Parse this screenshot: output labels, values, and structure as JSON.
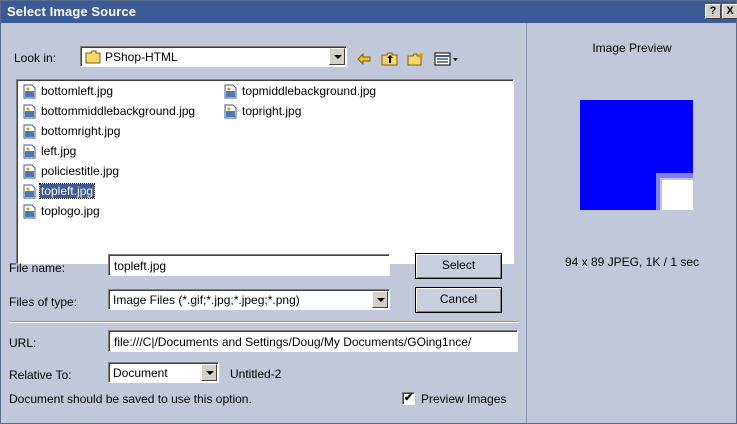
{
  "window": {
    "title": "Select Image Source",
    "help_label": "?",
    "close_label": "X"
  },
  "look_in": {
    "label": "Look in:",
    "value": "PShop-HTML"
  },
  "toolbar": {
    "back_icon": "back-arrow-icon",
    "up_icon": "up-folder-icon",
    "new_folder_icon": "new-folder-icon",
    "view_menu_icon": "view-menu-icon"
  },
  "files": [
    {
      "name": "bottomleft.jpg",
      "selected": false
    },
    {
      "name": "bottommiddlebackground.jpg",
      "selected": false
    },
    {
      "name": "bottomright.jpg",
      "selected": false
    },
    {
      "name": "left.jpg",
      "selected": false
    },
    {
      "name": "policiestitle.jpg",
      "selected": false
    },
    {
      "name": "topleft.jpg",
      "selected": true
    },
    {
      "name": "toplogo.jpg",
      "selected": false
    },
    {
      "name": "topmiddlebackground.jpg",
      "selected": false
    },
    {
      "name": "topright.jpg",
      "selected": false
    }
  ],
  "file_name": {
    "label": "File name:",
    "value": "topleft.jpg"
  },
  "files_of_type": {
    "label": "Files of type:",
    "value": "Image Files (*.gif;*.jpg;*.jpeg;*.png)"
  },
  "buttons": {
    "select": "Select",
    "cancel": "Cancel"
  },
  "url": {
    "label": "URL:",
    "value": "file:///C|/Documents and Settings/Doug/My Documents/GOing1nce/"
  },
  "relative_to": {
    "label": "Relative To:",
    "value": "Document",
    "doc_name": "Untitled-2"
  },
  "note": "Document should be saved to use this option.",
  "preview_images": {
    "label": "Preview Images",
    "checked": true,
    "check_mark": "✔"
  },
  "preview": {
    "title": "Image Preview",
    "info": "94 x 89 JPEG, 1K / 1 sec"
  },
  "colors": {
    "titlebar": "#3c5a96",
    "dialog_bg": "#c0c8d9",
    "preview_blue": "#0000ff"
  }
}
